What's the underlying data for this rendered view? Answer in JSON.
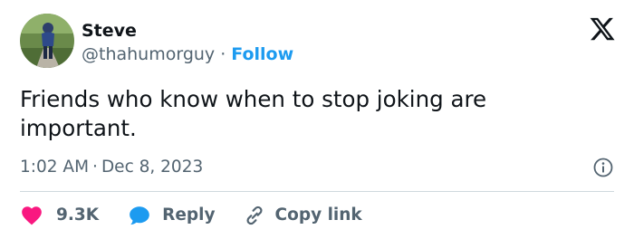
{
  "author": {
    "display_name": "Steve",
    "handle": "@thahumorguy",
    "separator": "·",
    "follow_label": "Follow"
  },
  "tweet": {
    "text": "Friends who know when to stop joking are important.",
    "time": "1:02 AM",
    "separator": "·",
    "date": "Dec 8, 2023"
  },
  "actions": {
    "like_count": "9.3K",
    "reply_label": "Reply",
    "copy_link_label": "Copy link"
  },
  "colors": {
    "accent": "#1d9bf0",
    "like": "#f91880",
    "text_primary": "#0f1419",
    "text_secondary": "#536471",
    "divider": "#cfd9de"
  },
  "icons": {
    "brand": "x-logo-icon",
    "info": "info-icon",
    "like": "heart-icon",
    "reply": "speech-bubble-icon",
    "copy_link": "link-icon"
  }
}
